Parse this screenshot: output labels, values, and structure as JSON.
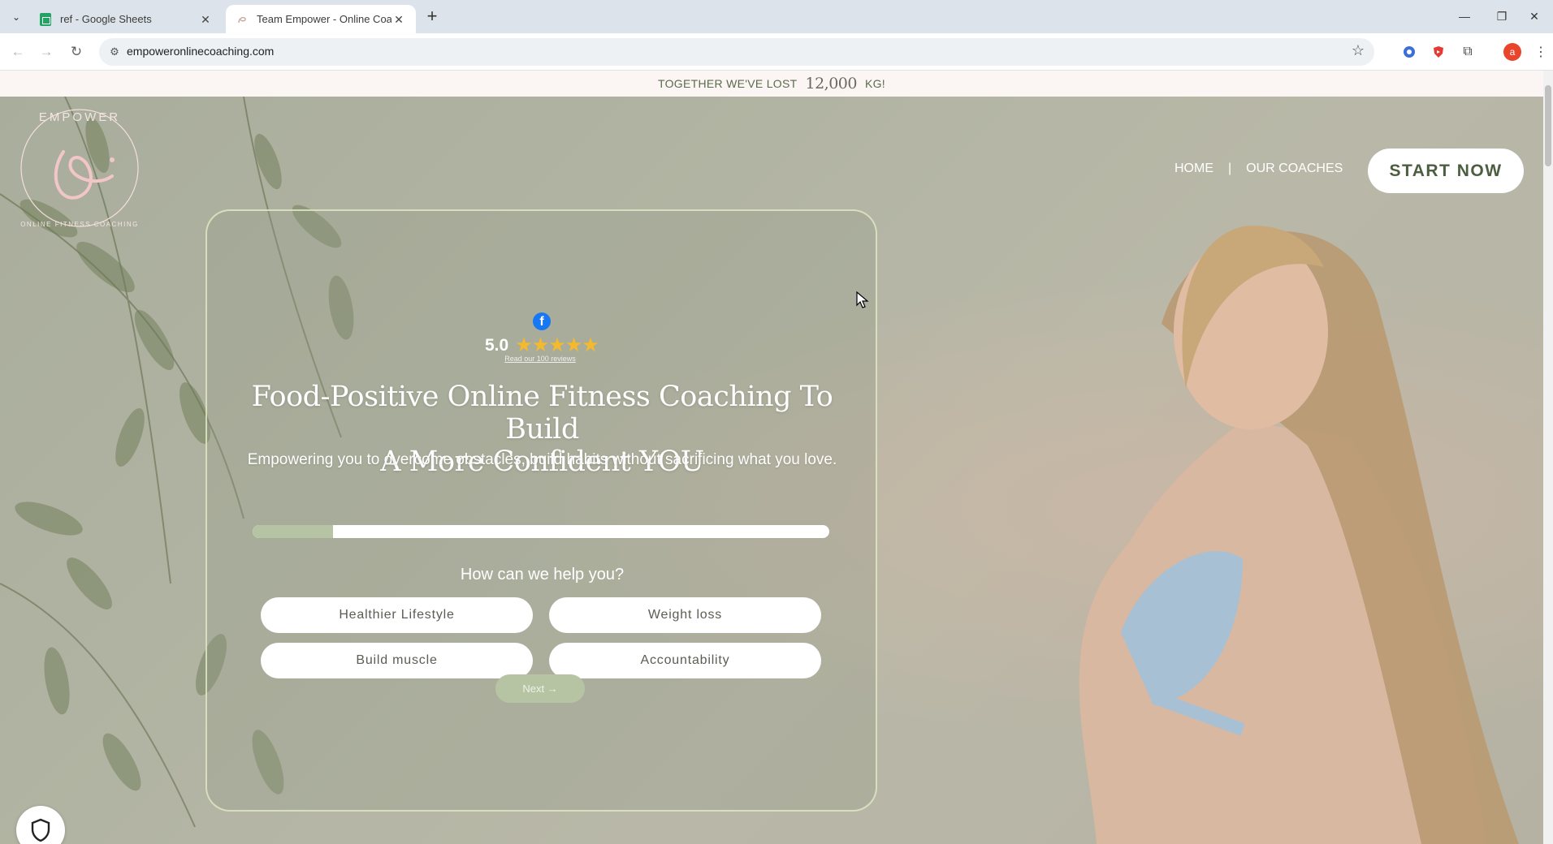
{
  "browser": {
    "tabs": [
      {
        "title": "ref - Google Sheets",
        "favicon": "google-sheets-icon",
        "active": false
      },
      {
        "title": "Team Empower - Online Coachi",
        "favicon": "empower-favicon",
        "active": true
      }
    ],
    "url": "empoweronlinecoaching.com",
    "profile_initial": "a"
  },
  "announcement": {
    "prefix": "TOGETHER WE'VE LOST",
    "number": "12,000",
    "suffix": "KG!"
  },
  "logo": {
    "top_text": "EMPOWER",
    "bottom_text": "ONLINE FITNESS COACHING"
  },
  "nav": {
    "home": "HOME",
    "separator": "|",
    "coaches": "OUR COACHES",
    "cta": "START NOW"
  },
  "hero": {
    "facebook_icon": "f",
    "rating_score": "5.0",
    "stars": "★★★★★",
    "rating_value": 5,
    "reviews_link": "Read our 100 reviews",
    "headline_line1": "Food-Positive Online Fitness Coaching To Build",
    "headline_line2": "A More Confident YOU",
    "subheadline": "Empowering you to overcome obstacles, build habits without sacrificing what you love.",
    "progress_fraction": 0.14,
    "question": "How can we help you?",
    "options": [
      "Healthier Lifestyle",
      "Weight loss",
      "Build muscle",
      "Accountability"
    ],
    "next_label": "Next →"
  },
  "colors": {
    "accent_green": "#4c5e3f",
    "progress_fill": "#b7c4a3",
    "star_gold": "#f5b92c",
    "facebook_blue": "#1877f2",
    "logo_pink": "#f2c6c6"
  }
}
